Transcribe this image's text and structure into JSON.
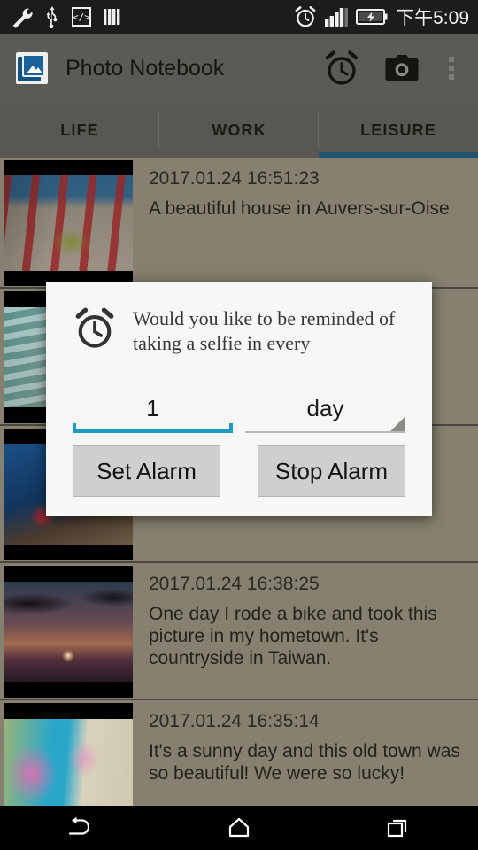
{
  "status_bar": {
    "icons_left": [
      "wrench-icon",
      "usb-icon",
      "code-icon",
      "bars-icon"
    ],
    "icons_right": [
      "alarm-icon",
      "signal-icon",
      "battery-charging-icon"
    ],
    "time": "下午5:09"
  },
  "app_bar": {
    "title": "Photo Notebook",
    "app_icon": "photo-album-icon",
    "actions": [
      {
        "name": "alarm-icon",
        "label": "Alarm"
      },
      {
        "name": "camera-icon",
        "label": "Camera"
      },
      {
        "name": "overflow-menu-icon",
        "label": "More options"
      }
    ]
  },
  "tabs": {
    "items": [
      {
        "label": "LIFE",
        "active": false
      },
      {
        "label": "WORK",
        "active": false
      },
      {
        "label": "LEISURE",
        "active": true
      }
    ],
    "indicator_color": "#1f5572"
  },
  "list": {
    "items": [
      {
        "date": "2017.01.24 16:51:23",
        "description": "A beautiful house in Auvers-sur-Oise",
        "thumb": "art-house"
      },
      {
        "date": "",
        "description": "",
        "thumb": "art-stairs"
      },
      {
        "date": "",
        "description": "",
        "thumb": "art-city"
      },
      {
        "date": "2017.01.24 16:38:25",
        "description": "One day I rode a bike and took this picture in my hometown. It's countryside in Taiwan.",
        "thumb": "art-sunset"
      },
      {
        "date": "2017.01.24 16:35:14",
        "description": "It's a sunny day and this old town was so beautiful! We were so lucky!",
        "thumb": "art-flowers"
      }
    ]
  },
  "dialog": {
    "icon": "alarm-clock-icon",
    "message": "Would you like to be reminded of taking a selfie in every",
    "interval_value": "1",
    "interval_unit": "day",
    "set_button": "Set Alarm",
    "stop_button": "Stop Alarm",
    "accent_color": "#1d9bc4"
  },
  "nav_bar": {
    "buttons": [
      "back-icon",
      "home-icon",
      "recents-icon"
    ]
  }
}
